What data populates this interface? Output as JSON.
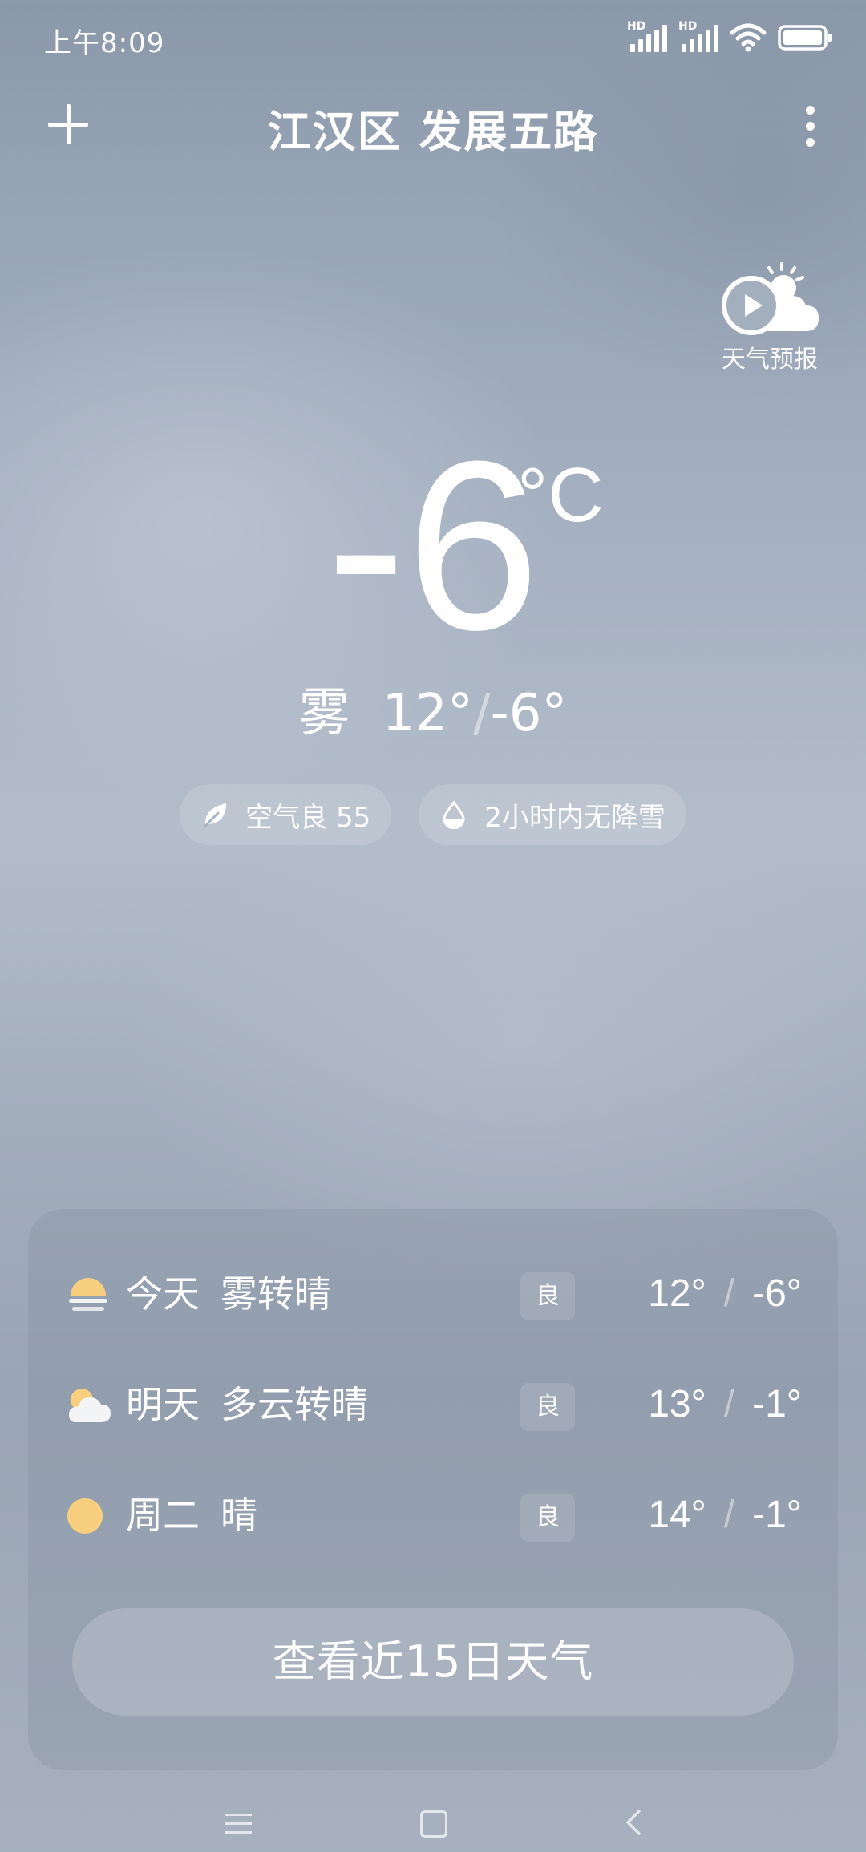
{
  "status_bar": {
    "time": "上午8:09",
    "icons": [
      "hd-signal-icon",
      "hd-signal-icon",
      "wifi-icon",
      "battery-icon"
    ],
    "hd_label": "HD"
  },
  "header": {
    "location": "江汉区 发展五路",
    "add_icon": "plus-icon",
    "more_icon": "more-vertical-icon"
  },
  "forecast_video": {
    "label": "天气预报",
    "icon": "play-sun-cloud-icon"
  },
  "current": {
    "temperature": "-6",
    "unit": "°C",
    "condition": "雾",
    "high": "12°",
    "separator": "/",
    "low": "-6°"
  },
  "chips": {
    "air_quality": {
      "label": "空气良 55",
      "icon": "leaf-icon"
    },
    "precipitation": {
      "label": "2小时内无降雪",
      "icon": "water-drop-icon"
    }
  },
  "forecast": {
    "days": [
      {
        "day": "今天",
        "desc": "雾转晴",
        "aqi": "良",
        "high": "12°",
        "low": "-6°",
        "icon": "fog-sun-icon"
      },
      {
        "day": "明天",
        "desc": "多云转晴",
        "aqi": "良",
        "high": "13°",
        "low": "-1°",
        "icon": "partly-cloudy-icon"
      },
      {
        "day": "周二",
        "desc": "晴",
        "aqi": "良",
        "high": "14°",
        "low": "-1°",
        "icon": "sun-icon"
      }
    ],
    "range_separator": "/",
    "view_15_label": "查看近15日天气"
  },
  "nav_bar": {
    "icons": [
      "menu-icon",
      "home-icon",
      "back-icon"
    ]
  },
  "colors": {
    "sun": "#f8cf7e",
    "text": "#ffffff"
  }
}
